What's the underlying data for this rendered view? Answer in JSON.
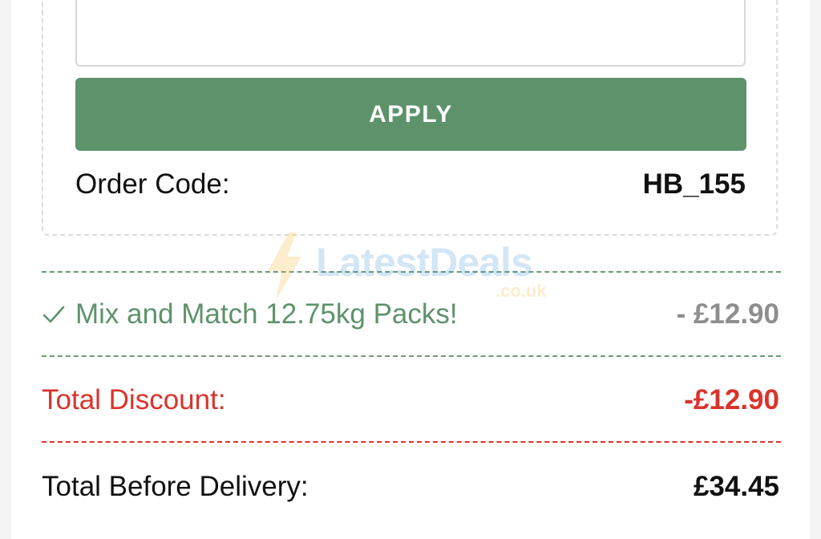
{
  "promo": {
    "input_value": "",
    "apply_label": "APPLY"
  },
  "order": {
    "label": "Order Code:",
    "value": "HB_155"
  },
  "discounts": [
    {
      "label": "Mix and Match 12.75kg Packs!",
      "amount": "- £12.90",
      "icon": "check-icon"
    }
  ],
  "summary": {
    "total_discount_label": "Total Discount:",
    "total_discount_value": "-£12.90",
    "total_before_delivery_label": "Total Before Delivery:",
    "total_before_delivery_value": "£34.45"
  },
  "watermark": {
    "brand": "LatestDeals",
    "domain": ".co.uk"
  },
  "colors": {
    "accent_green": "#5e926b",
    "discount_red": "#d9342b",
    "muted_gray": "#8e8e8e"
  }
}
